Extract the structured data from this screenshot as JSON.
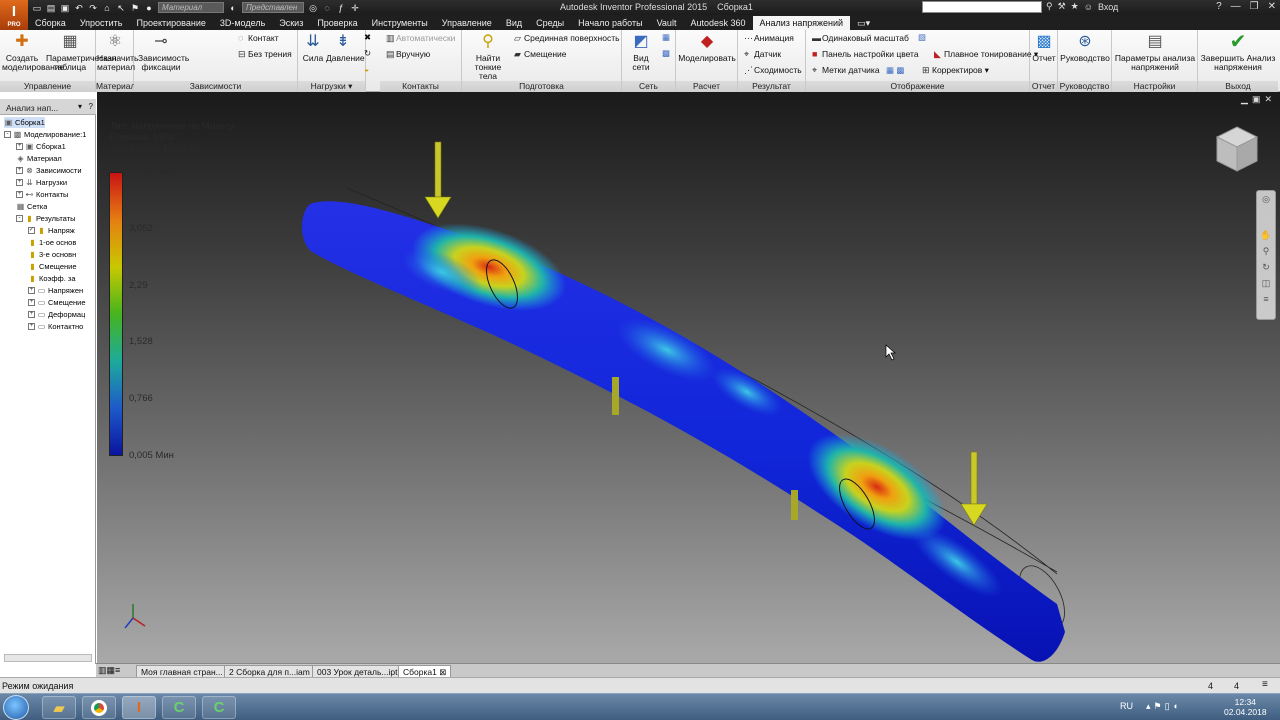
{
  "app": {
    "logo": "I",
    "logo_sub": "PRO",
    "title": "Autodesk Inventor Professional 2015",
    "document": "Сборка1",
    "material_combo": "Материал",
    "appearance_combo": "Представлен",
    "signin": "Вход"
  },
  "tabs": [
    {
      "label": "Сборка",
      "active": false
    },
    {
      "label": "Упростить",
      "active": false
    },
    {
      "label": "Проектирование",
      "active": false
    },
    {
      "label": "3D-модель",
      "active": false
    },
    {
      "label": "Эскиз",
      "active": false
    },
    {
      "label": "Проверка",
      "active": false
    },
    {
      "label": "Инструменты",
      "active": false
    },
    {
      "label": "Управление",
      "active": false
    },
    {
      "label": "Вид",
      "active": false
    },
    {
      "label": "Среды",
      "active": false
    },
    {
      "label": "Начало работы",
      "active": false
    },
    {
      "label": "Vault",
      "active": false
    },
    {
      "label": "Autodesk 360",
      "active": false
    },
    {
      "label": "Анализ напряжений",
      "active": true
    }
  ],
  "ribbon": {
    "manage": {
      "title": "Управление",
      "create": "Создать моделирование",
      "param_table": "Параметрическая таблица"
    },
    "material": {
      "title": "Материал",
      "assign": "Назначить материал"
    },
    "constraints": {
      "title": "Зависимости",
      "fixed": "Зависимость фиксации",
      "contact": "Контакт",
      "frictionless": "Без трения"
    },
    "loads": {
      "title": "Нагрузки",
      "force": "Сила",
      "pressure": "Давление"
    },
    "contacts": {
      "title": "Контакты",
      "automatic": "Автоматически",
      "manual": "Вручную"
    },
    "prepare": {
      "title": "Подготовка",
      "find_thin": "Найти тонкие тела",
      "midsurface": "Срединная поверхность",
      "offset": "Смещение"
    },
    "mesh": {
      "title": "Сеть",
      "view": "Вид сети"
    },
    "solve": {
      "title": "Расчет",
      "simulate": "Моделировать"
    },
    "result": {
      "title": "Результат",
      "animate": "Анимация",
      "probe": "Датчик",
      "convergence": "Сходимость"
    },
    "display": {
      "title": "Отображение",
      "same_scale": "Одинаковый масштаб",
      "color_bar": "Панель настройки цвета",
      "probe_labels": "Метки датчика",
      "smooth_shading": "Плавное тонирование",
      "adjust": "Корректиров"
    },
    "report": {
      "title": "Отчет",
      "label": "Отчет"
    },
    "guide": {
      "title": "Руководство",
      "label": "Руководство"
    },
    "settings": {
      "title": "Настройки",
      "label": "Параметры анализа напряжений"
    },
    "exit": {
      "title": "Выход",
      "label": "Завершить Анализ напряжения"
    }
  },
  "browser": {
    "header": "Анализ нап...",
    "nodes": [
      {
        "label": "Сборка1",
        "level": 0,
        "icon": "assembly-icon",
        "expander": ""
      },
      {
        "label": "Моделирование:1",
        "level": 0,
        "icon": "simulation-icon",
        "expander": "-"
      },
      {
        "label": "Сборка1",
        "level": 1,
        "icon": "assembly-icon",
        "expander": "+"
      },
      {
        "label": "Материал",
        "level": 1,
        "icon": "material-icon",
        "expander": ""
      },
      {
        "label": "Зависимости",
        "level": 1,
        "icon": "constraints-icon",
        "expander": "+"
      },
      {
        "label": "Нагрузки",
        "level": 1,
        "icon": "loads-icon",
        "expander": "+"
      },
      {
        "label": "Контакты",
        "level": 1,
        "icon": "contacts-icon",
        "expander": "+"
      },
      {
        "label": "Сетка",
        "level": 1,
        "icon": "mesh-icon",
        "expander": ""
      },
      {
        "label": "Результаты",
        "level": 1,
        "icon": "results-icon",
        "expander": "-"
      },
      {
        "label": "Напряж",
        "level": 2,
        "icon": "result-item-icon",
        "expander": "",
        "checked": true
      },
      {
        "label": "1-ое основ",
        "level": 2,
        "icon": "result-item-icon",
        "expander": ""
      },
      {
        "label": "3-е основн",
        "level": 2,
        "icon": "result-item-icon",
        "expander": ""
      },
      {
        "label": "Смещение",
        "level": 2,
        "icon": "result-item-icon",
        "expander": ""
      },
      {
        "label": "Коэфф. за",
        "level": 2,
        "icon": "result-item-icon",
        "expander": ""
      },
      {
        "label": "Напряжен",
        "level": 2,
        "icon": "folder-icon",
        "expander": "+"
      },
      {
        "label": "Смещение",
        "level": 2,
        "icon": "folder-icon",
        "expander": "+"
      },
      {
        "label": "Деформац",
        "level": 2,
        "icon": "folder-icon",
        "expander": "+"
      },
      {
        "label": "Контактно",
        "level": 2,
        "icon": "folder-icon",
        "expander": "+"
      }
    ]
  },
  "legend": {
    "type_line": "Тип: Напряжение по Мизесу",
    "unit_line": "Единица: MPa",
    "date_line": "02.04.2018, 12:34:24",
    "ticks": [
      {
        "value": "3,814 Макс",
        "frac": 1.0
      },
      {
        "value": "3,052",
        "frac": 0.8
      },
      {
        "value": "2,29",
        "frac": 0.6
      },
      {
        "value": "1,528",
        "frac": 0.4
      },
      {
        "value": "0,766",
        "frac": 0.2
      },
      {
        "value": "0,005 Мин",
        "frac": 0.0
      }
    ],
    "colors": [
      "#c81414",
      "#e67e12",
      "#c8c800",
      "#46b41e",
      "#1eaa9b",
      "#1e5ac8",
      "#0a14a0"
    ]
  },
  "doc_tabs": [
    {
      "label": "Моя главная стран...",
      "active": false
    },
    {
      "label": "2 Сборка для п...iam",
      "active": false
    },
    {
      "label": "003 Урок деталь...ipt",
      "active": false
    },
    {
      "label": "Сборка1",
      "active": true
    }
  ],
  "status": {
    "text": "Режим ожидания",
    "n1": "4",
    "n2": "4"
  },
  "taskbar": {
    "lang": "RU",
    "time": "12:34",
    "date": "02.04.2018"
  }
}
